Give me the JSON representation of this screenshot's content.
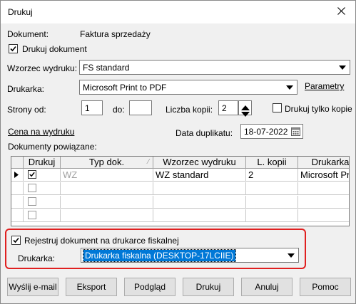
{
  "window": {
    "title": "Drukuj",
    "close_glyph": "✕"
  },
  "document": {
    "label": "Dokument:",
    "value": "Faktura sprzedaży"
  },
  "print_document": {
    "label": "Drukuj dokument",
    "checked": true
  },
  "template": {
    "label": "Wzorzec wydruku:",
    "value": "FS standard"
  },
  "printer": {
    "label": "Drukarka:",
    "value": "Microsoft Print to PDF",
    "params_link": "Parametry"
  },
  "pages": {
    "from_label": "Strony od:",
    "from_value": "1",
    "to_label": "do:",
    "to_value": ""
  },
  "copies": {
    "label": "Liczba kopii:",
    "value": "2"
  },
  "print_copy_only": {
    "label": "Drukuj tylko kopie",
    "checked": false
  },
  "price_link": "Cena na wydruku",
  "duplicate_date": {
    "label": "Data duplikatu:",
    "value": "18-07-2022"
  },
  "related": {
    "label": "Dokumenty powiązane:",
    "columns": [
      "Drukuj",
      "Typ dok.",
      "Wzorzec wydruku",
      "L. kopii",
      "Drukarka"
    ],
    "rows": [
      {
        "print": true,
        "type": "WZ",
        "template": "WZ standard",
        "copies": "2",
        "printer": "Microsoft Pri",
        "current": true
      },
      {
        "print": false,
        "type": "",
        "template": "",
        "copies": "",
        "printer": "",
        "current": false
      },
      {
        "print": false,
        "type": "",
        "template": "",
        "copies": "",
        "printer": "",
        "current": false
      },
      {
        "print": false,
        "type": "",
        "template": "",
        "copies": "",
        "printer": "",
        "current": false
      }
    ]
  },
  "fiscal": {
    "register_label": "Rejestruj dokument na drukarce fiskalnej",
    "checked": true,
    "printer_label": "Drukarka:",
    "printer_value": "Drukarka fiskalna (DESKTOP-17LCIIE)"
  },
  "buttons": {
    "email": "Wyślij e-mail",
    "export": "Eksport",
    "preview": "Podgląd",
    "print": "Drukuj",
    "cancel": "Anuluj",
    "help": "Pomoc"
  },
  "colors": {
    "highlight": "#0078d7",
    "fiscal_border": "#e02020"
  }
}
